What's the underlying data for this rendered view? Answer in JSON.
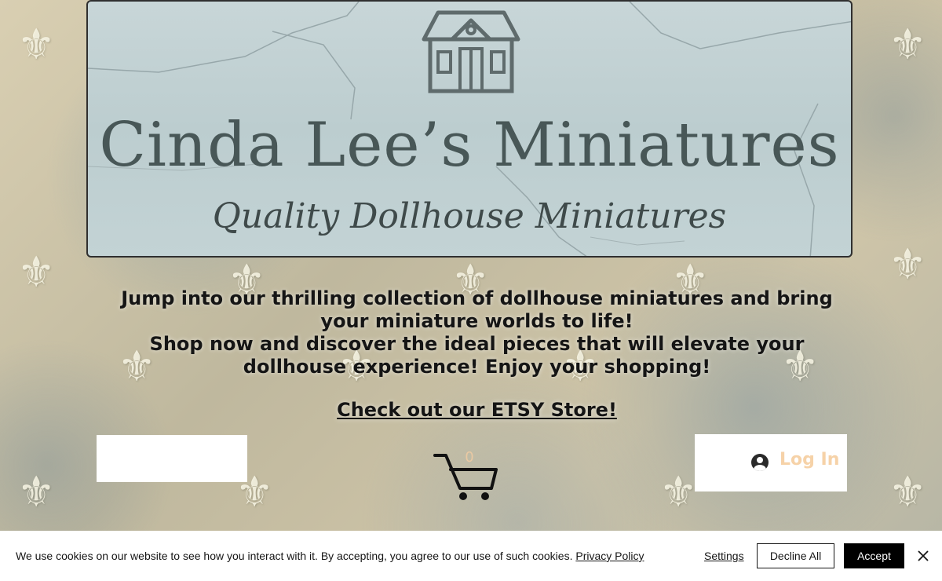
{
  "banner": {
    "brand_title": "Cinda Lee’s Miniatures",
    "tagline": "Quality Dollhouse Miniatures",
    "logo_icon": "house-icon"
  },
  "intro": {
    "line1": "Jump into our thrilling collection of dollhouse miniatures and bring your miniature worlds to life!",
    "line2": "Shop now and discover the ideal pieces that will elevate your dollhouse experience! Enjoy your shopping!"
  },
  "etsy_link": "Check out our ETSY Store!",
  "cart": {
    "icon": "shopping-cart-icon",
    "count": "0"
  },
  "login": {
    "icon": "user-avatar-icon",
    "label": "Log In"
  },
  "cookie_banner": {
    "message": "We use cookies on our website to see how you interact with it. By accepting, you agree to our use of such cookies.",
    "privacy_link": "Privacy Policy",
    "settings": "Settings",
    "decline": "Decline All",
    "accept": "Accept",
    "close_icon": "close-icon"
  },
  "colors": {
    "banner_bg": "#c3d3d5",
    "brand_text": "#485757",
    "login_text": "#f6d2a8",
    "accept_bg": "#000000"
  }
}
